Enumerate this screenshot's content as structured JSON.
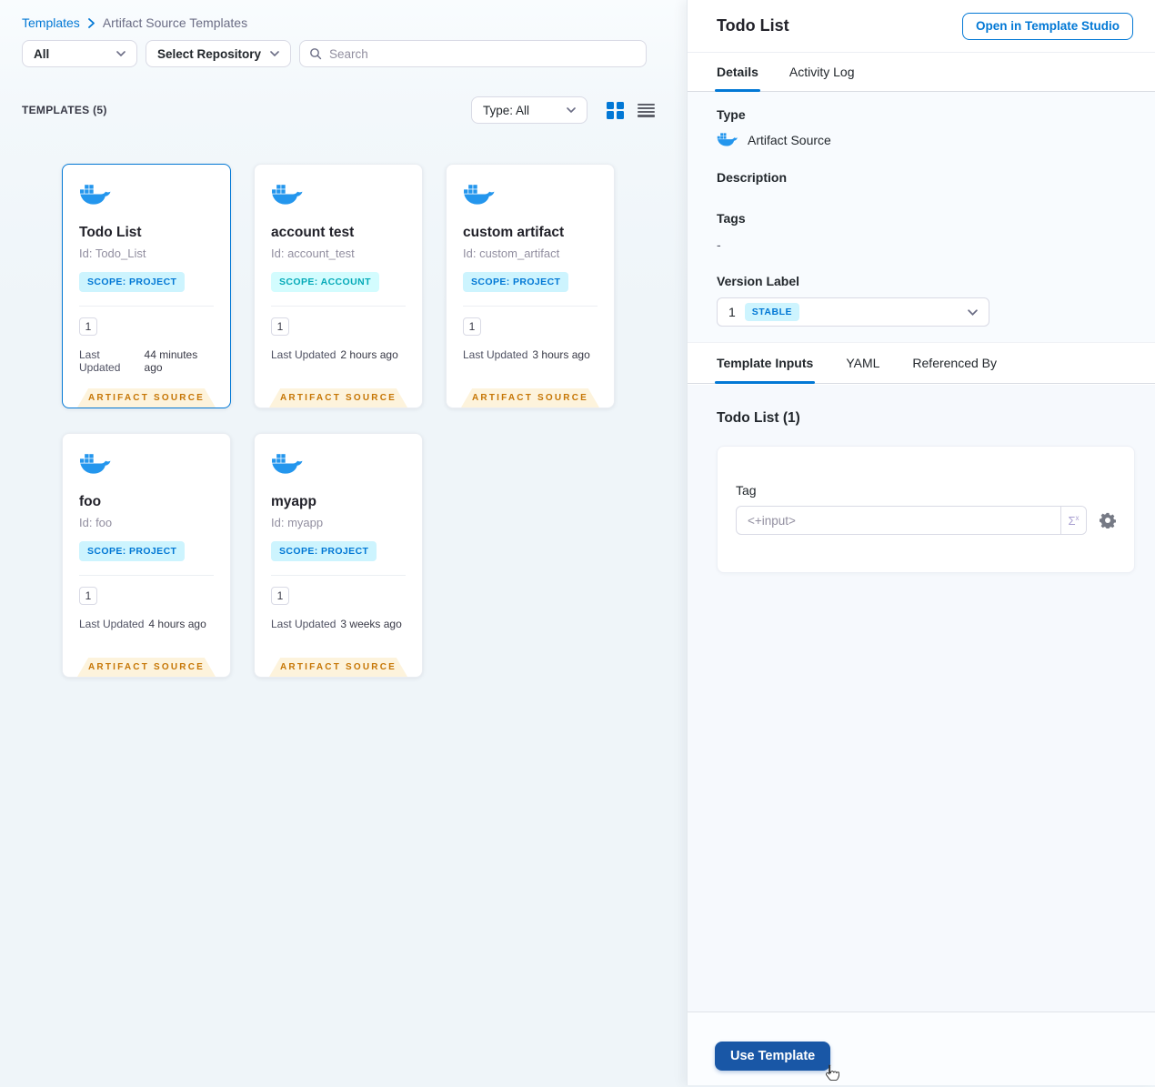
{
  "colors": {
    "accent": "#0278d5",
    "docker_blue": "#2496ed",
    "scope_project_bg": "#cdf4fe",
    "scope_project_text": "#0278d5",
    "scope_account_bg": "#d3fcfe",
    "scope_account_text": "#05aab8",
    "ribbon_bg": "#fdf3dc",
    "ribbon_text": "#c67605",
    "stable_badge_bg": "#cdf4fe",
    "use_template_bg": "#1957a6"
  },
  "left": {
    "breadcrumb": {
      "link": "Templates",
      "current": "Artifact Source Templates"
    },
    "filters": {
      "scope": "All",
      "repository": "Select Repository",
      "search_placeholder": "Search"
    },
    "header": {
      "count": "TEMPLATES (5)",
      "type_filter": "Type: All"
    },
    "labels": {
      "last_updated": "Last Updated"
    },
    "cards": [
      {
        "title": "Todo List",
        "id": "Id: Todo_List",
        "scope": "SCOPE: PROJECT",
        "version": "1",
        "last_updated": "44 minutes ago",
        "ribbon": "ARTIFACT SOURCE"
      },
      {
        "title": "account test",
        "id": "Id: account_test",
        "scope": "SCOPE: ACCOUNT",
        "version": "1",
        "last_updated": "2 hours ago",
        "ribbon": "ARTIFACT SOURCE"
      },
      {
        "title": "custom artifact",
        "id": "Id: custom_artifact",
        "scope": "SCOPE: PROJECT",
        "version": "1",
        "last_updated": "3 hours ago",
        "ribbon": "ARTIFACT SOURCE"
      },
      {
        "title": "foo",
        "id": "Id: foo",
        "scope": "SCOPE: PROJECT",
        "version": "1",
        "last_updated": "4 hours ago",
        "ribbon": "ARTIFACT SOURCE"
      },
      {
        "title": "myapp",
        "id": "Id: myapp",
        "scope": "SCOPE: PROJECT",
        "version": "1",
        "last_updated": "3 weeks ago",
        "ribbon": "ARTIFACT SOURCE"
      }
    ]
  },
  "panel": {
    "title": "Todo List",
    "open_button": "Open in Template Studio",
    "tabs": {
      "details": "Details",
      "activity_log": "Activity Log"
    },
    "details": {
      "type_label": "Type",
      "type_value": "Artifact Source",
      "description_label": "Description",
      "tags_label": "Tags",
      "tags_value": "-",
      "version_label": "Version Label",
      "version_value": "1",
      "version_badge": "STABLE"
    },
    "inner_tabs": {
      "template_inputs": "Template Inputs",
      "yaml": "YAML",
      "referenced_by": "Referenced By"
    },
    "inputs": {
      "heading": "Todo List (1)",
      "tag_label": "Tag",
      "tag_value": "<+input>",
      "expression_symbol": "Σ",
      "expression_sup": "x"
    },
    "footer": {
      "use_template": "Use Template"
    }
  }
}
